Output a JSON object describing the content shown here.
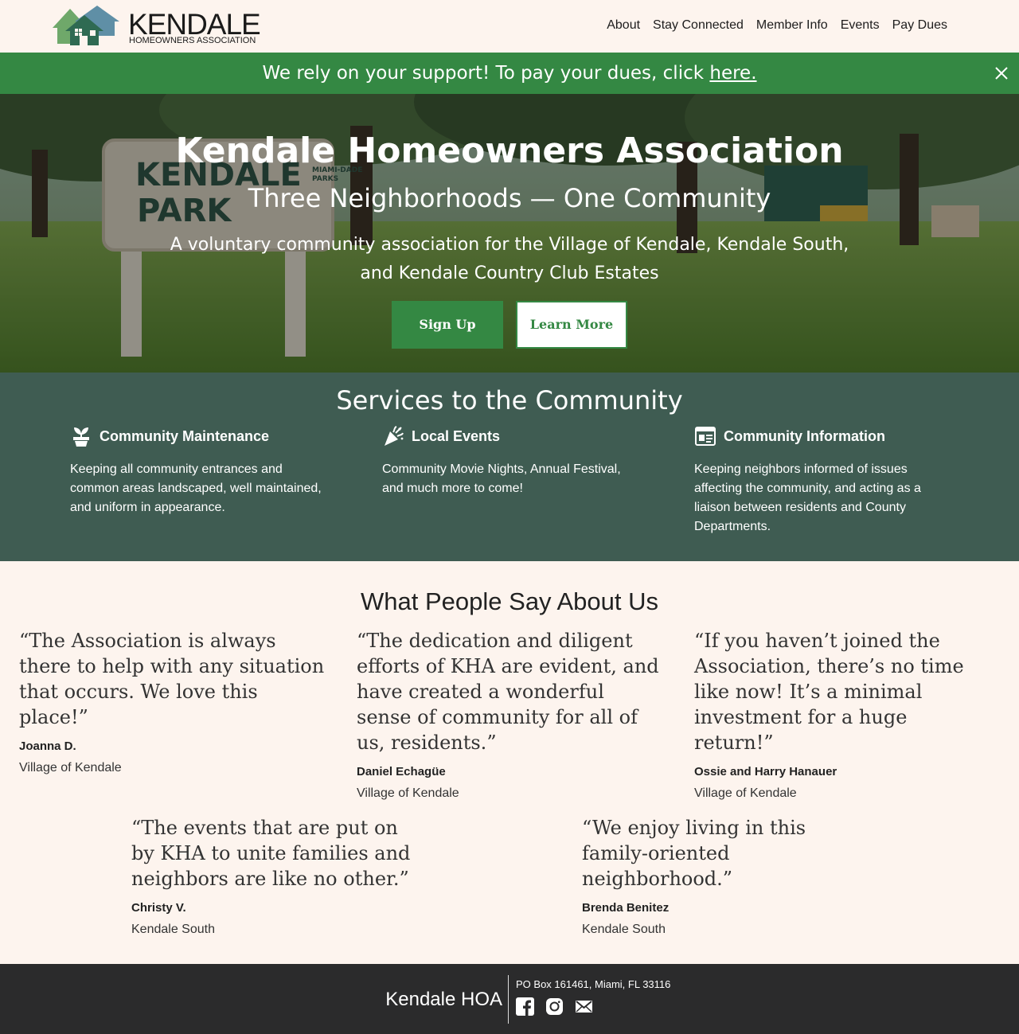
{
  "header": {
    "logo_title": "KENDALE",
    "logo_subtitle": "HOMEOWNERS ASSOCIATION",
    "nav": [
      "About",
      "Stay Connected",
      "Member Info",
      "Events",
      "Pay Dues"
    ]
  },
  "banner": {
    "text": "We rely on your support! To pay your dues, click ",
    "link": "here."
  },
  "hero": {
    "title": "Kendale Homeowners Association",
    "subtitle": "Three Neighborhoods — One Community",
    "description": "A voluntary community association for the Village of Kendale, Kendale South, and Kendale Country Club Estates",
    "sign_up": "Sign Up",
    "learn_more": "Learn More",
    "sign_lines": [
      "KENDALE",
      "PARK"
    ],
    "sign_badge": [
      "MIAMI-DADE",
      "PARKS"
    ]
  },
  "services": {
    "title": "Services to the Community",
    "items": [
      {
        "icon": "plant-pot-icon",
        "title": "Community Maintenance",
        "desc": "Keeping all community entrances and common areas landscaped, well maintained, and uniform in appearance."
      },
      {
        "icon": "party-popper-icon",
        "title": "Local Events",
        "desc": "Community Movie Nights, Annual Festival, and much more to come!"
      },
      {
        "icon": "newspaper-icon",
        "title": "Community Information",
        "desc": "Keeping neighbors informed of issues affecting the community, and acting as a liaison between residents and County Departments."
      }
    ]
  },
  "testimonials": {
    "title": "What People Say About Us",
    "items": [
      {
        "quote": "“The Association is always there to help with any situation that occurs. We love this place!”",
        "name": "Joanna D.",
        "place": "Village of Kendale"
      },
      {
        "quote": "“The dedication and diligent efforts of KHA are evident, and have created a wonderful sense of community for all of us, residents.”",
        "name": "Daniel Echagüe",
        "place": "Village of Kendale"
      },
      {
        "quote": "“If you haven’t joined the Association, there’s no time like now! It’s a minimal investment for a huge return!”",
        "name": "Ossie and Harry Hanauer",
        "place": "Village of Kendale"
      },
      {
        "quote": "“The events that are put on by KHA to unite families and neighbors are like no other.”",
        "name": "Christy V.",
        "place": "Kendale South"
      },
      {
        "quote": "“We enjoy living in this family-oriented neighborhood.”",
        "name": "Brenda Benitez",
        "place": "Kendale South"
      }
    ]
  },
  "footer": {
    "brand": "Kendale HOA",
    "address": "PO Box 161461, Miami, FL 33116",
    "icons": [
      "facebook-icon",
      "instagram-icon",
      "email-icon"
    ]
  },
  "colors": {
    "accent_green": "#348843",
    "services_bg": "#3f5c52",
    "page_bg": "#fdf4ee",
    "footer_bg": "#2b2b2c"
  }
}
